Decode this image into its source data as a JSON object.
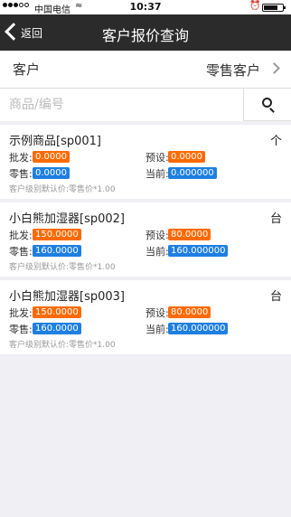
{
  "status_bar": {
    "carrier": "中国电信",
    "wifi_icon": "wifi-icon",
    "time": "10:37",
    "alarm_icon": "alarm-icon",
    "battery_icon": "battery-icon"
  },
  "navbar": {
    "back_label": "返回",
    "title": "客户报价查询"
  },
  "customer": {
    "label": "客户",
    "value": "零售客户"
  },
  "search": {
    "placeholder": "商品/编号",
    "value": ""
  },
  "products": [
    {
      "name": "示例商品[sp001]",
      "unit": "个",
      "wholesale_label": "批发:",
      "wholesale": "0.0000",
      "preset_label": "预设:",
      "preset": "0.0000",
      "retail_label": "零售:",
      "retail": "0.0000",
      "current_label": "当前:",
      "current": "0.000000",
      "note": "客户级别默认价:零售价*1.00"
    },
    {
      "name": "小白熊加湿器[sp002]",
      "unit": "台",
      "wholesale_label": "批发:",
      "wholesale": "150.0000",
      "preset_label": "预设:",
      "preset": "80.0000",
      "retail_label": "零售:",
      "retail": "160.0000",
      "current_label": "当前:",
      "current": "160.000000",
      "note": "客户级别默认价:零售价*1.00"
    },
    {
      "name": "小白熊加湿器[sp003]",
      "unit": "台",
      "wholesale_label": "批发:",
      "wholesale": "150.0000",
      "preset_label": "预设:",
      "preset": "80.0000",
      "retail_label": "零售:",
      "retail": "160.0000",
      "current_label": "当前:",
      "current": "160.000000",
      "note": "客户级别默认价:零售价*1.00"
    }
  ],
  "colors": {
    "navbar_bg": "#2b2b2b",
    "tag_orange": "#ff6a00",
    "tag_blue": "#1e7fe0",
    "page_bg": "#efeff4"
  }
}
